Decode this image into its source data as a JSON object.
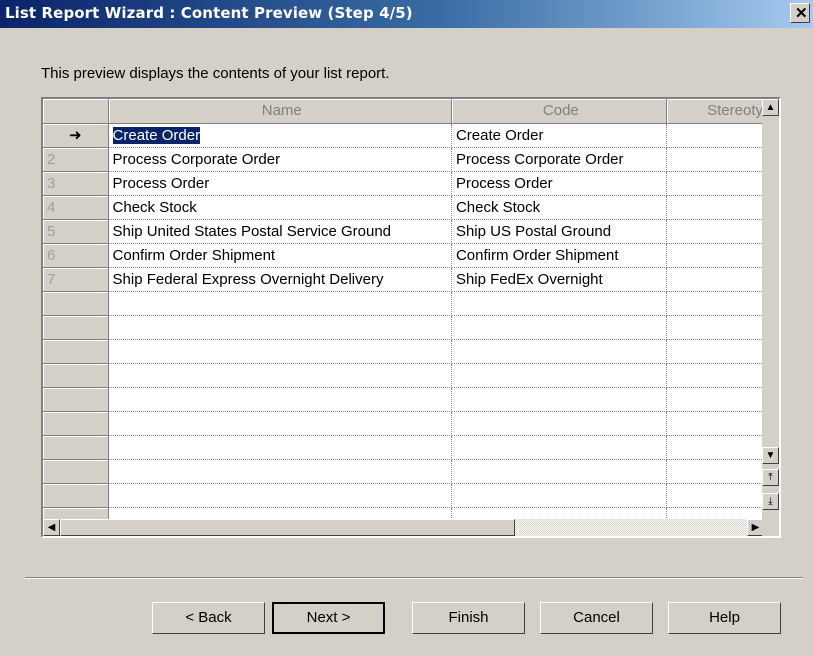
{
  "window": {
    "title": "List Report Wizard : Content Preview (Step 4/5)",
    "close_label": "✕"
  },
  "intro_text": "This preview displays the contents of your list report.",
  "grid": {
    "columns": [
      "Name",
      "Code",
      "Stereoty"
    ],
    "current_row_marker": "➜",
    "rows": [
      {
        "num": "",
        "name": "Create Order",
        "code": "Create Order",
        "stereotype": ""
      },
      {
        "num": "2",
        "name": "Process Corporate Order",
        "code": "Process Corporate Order",
        "stereotype": ""
      },
      {
        "num": "3",
        "name": "Process Order",
        "code": "Process Order",
        "stereotype": ""
      },
      {
        "num": "4",
        "name": "Check Stock",
        "code": "Check Stock",
        "stereotype": ""
      },
      {
        "num": "5",
        "name": "Ship United States Postal Service Ground",
        "code": "Ship US Postal Ground",
        "stereotype": ""
      },
      {
        "num": "6",
        "name": "Confirm Order Shipment",
        "code": "Confirm Order Shipment",
        "stereotype": ""
      },
      {
        "num": "7",
        "name": "Ship Federal Express Overnight Delivery",
        "code": "Ship FedEx Overnight",
        "stereotype": ""
      }
    ],
    "empty_rows": 10
  },
  "buttons": {
    "back": "< Back",
    "next": "Next >",
    "finish": "Finish",
    "cancel": "Cancel",
    "help": "Help"
  },
  "colors": {
    "selection": "#0a246a",
    "titlebar": "#0a246a",
    "face": "#d4d0c8"
  }
}
